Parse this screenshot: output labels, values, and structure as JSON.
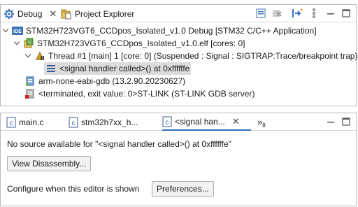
{
  "debug_view": {
    "tabs": [
      {
        "label": "Debug",
        "icon": "debug-gear-icon",
        "active": true
      },
      {
        "label": "Project Explorer",
        "icon": "project-explorer-icon",
        "active": false
      }
    ],
    "tree": [
      {
        "label": "STM32H723VGT6_CCDpos_Isolated_v1.0 Debug [STM32 C/C++ Application]",
        "icon": "ide-launch-icon",
        "expanded": true
      },
      {
        "label": "STM32H723VGT6_CCDpos_Isolated_v1.0.elf [cores: 0]",
        "icon": "process-icon",
        "expanded": true
      },
      {
        "label": "Thread #1 [main] 1 [core: 0] (Suspended : Signal : SIGTRAP:Trace/breakpoint trap)",
        "icon": "suspended-thread-icon",
        "expanded": true
      },
      {
        "label": "<signal handler called>() at 0xffffffe",
        "icon": "stack-frame-icon",
        "selected": true
      },
      {
        "label": "arm-none-eabi-gdb (13.2.90.20230627)",
        "icon": "gdb-process-icon"
      },
      {
        "label": "<terminated, exit value: 0>ST-LINK (ST-LINK GDB server)",
        "icon": "terminated-process-icon"
      }
    ]
  },
  "editor": {
    "tabs": [
      {
        "label": "main.c",
        "icon": "c-file-icon"
      },
      {
        "label": "stm32h7xx_h...",
        "icon": "c-file-icon"
      },
      {
        "label": "<signal han...",
        "icon": "c-file-icon",
        "active": true
      }
    ],
    "overflow_count": "8",
    "no_source_message": "No source available for \"<signal handler called>() at 0xffffffe\"",
    "view_disassembly_label": "View Disassembly...",
    "configure_label": "Configure when this editor is shown",
    "preferences_label": "Preferences..."
  }
}
